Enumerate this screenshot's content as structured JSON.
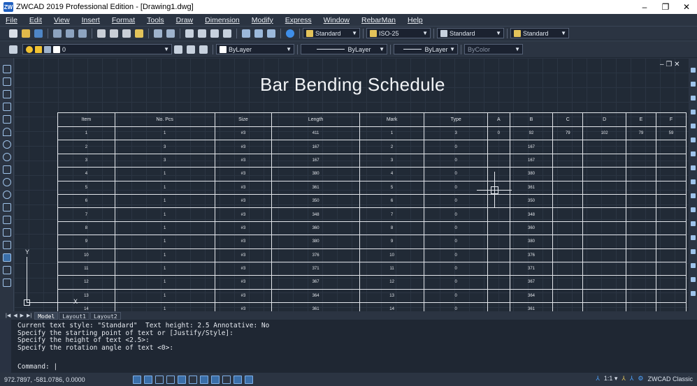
{
  "window": {
    "title": "ZWCAD 2019 Professional Edition - [Drawing1.dwg]",
    "logo": "ZW",
    "minimize": "–",
    "restore": "❐",
    "close": "✕"
  },
  "menu": [
    "File",
    "Edit",
    "View",
    "Insert",
    "Format",
    "Tools",
    "Draw",
    "Dimension",
    "Modify",
    "Express",
    "Window",
    "RebarMan",
    "Help"
  ],
  "toolbar": {
    "text_style": "Standard",
    "dim_style": "ISO-25",
    "table_style": "Standard",
    "multileader_style": "Standard",
    "layer": "0",
    "color": "ByLayer",
    "linetype": "ByLayer",
    "lineweight": "ByLayer",
    "plot_style": "ByColor"
  },
  "viewport": {
    "controls": "– ❐ ✕"
  },
  "schedule": {
    "title": "Bar Bending Schedule",
    "headers": [
      "Item",
      "No. Pcs",
      "Size",
      "Length",
      "Mark",
      "Type",
      "A",
      "B",
      "C",
      "D",
      "E",
      "F"
    ],
    "rows": [
      [
        "1",
        "1",
        "#3",
        "411",
        "1",
        "3",
        "0",
        "92",
        "79",
        "102",
        "79",
        "59"
      ],
      [
        "2",
        "3",
        "#3",
        "167",
        "2",
        "0",
        "",
        "167",
        "",
        "",
        "",
        ""
      ],
      [
        "3",
        "3",
        "#3",
        "167",
        "3",
        "0",
        "",
        "167",
        "",
        "",
        "",
        ""
      ],
      [
        "4",
        "1",
        "#3",
        "380",
        "4",
        "0",
        "",
        "380",
        "",
        "",
        "",
        ""
      ],
      [
        "5",
        "1",
        "#3",
        "361",
        "5",
        "0",
        "",
        "361",
        "",
        "",
        "",
        ""
      ],
      [
        "6",
        "1",
        "#3",
        "350",
        "6",
        "0",
        "",
        "350",
        "",
        "",
        "",
        ""
      ],
      [
        "7",
        "1",
        "#3",
        "348",
        "7",
        "0",
        "",
        "348",
        "",
        "",
        "",
        ""
      ],
      [
        "8",
        "1",
        "#3",
        "360",
        "8",
        "0",
        "",
        "360",
        "",
        "",
        "",
        ""
      ],
      [
        "9",
        "1",
        "#3",
        "380",
        "9",
        "0",
        "",
        "380",
        "",
        "",
        "",
        ""
      ],
      [
        "10",
        "1",
        "#3",
        "376",
        "10",
        "0",
        "",
        "376",
        "",
        "",
        "",
        ""
      ],
      [
        "11",
        "1",
        "#3",
        "371",
        "11",
        "0",
        "",
        "371",
        "",
        "",
        "",
        ""
      ],
      [
        "12",
        "1",
        "#3",
        "367",
        "12",
        "0",
        "",
        "367",
        "",
        "",
        "",
        ""
      ],
      [
        "13",
        "1",
        "#3",
        "364",
        "13",
        "0",
        "",
        "364",
        "",
        "",
        "",
        ""
      ],
      [
        "14",
        "1",
        "#3",
        "361",
        "14",
        "0",
        "",
        "361",
        "",
        "",
        "",
        ""
      ]
    ]
  },
  "ucs": {
    "y": "Y",
    "x": "X"
  },
  "tabs": {
    "nav": [
      "|◀",
      "◀",
      "▶",
      "▶|"
    ],
    "items": [
      "Model",
      "Layout1",
      "Layout2"
    ]
  },
  "command": {
    "history": [
      "Current text style: \"Standard\"  Text height: 2.5 Annotative: No",
      "Specify the starting point of text or [Justify/Style]:",
      "Specify the height of text <2.5>:",
      "Specify the rotation angle of text <0>:"
    ],
    "prompt": "Command: |"
  },
  "status": {
    "coords": "972.7897, -581.0786, 0.0000",
    "scale": "1:1 ▾",
    "workspace": "ZWCAD Classic"
  },
  "colors": {
    "accent": "#4da3ff",
    "background": "#212a36"
  }
}
